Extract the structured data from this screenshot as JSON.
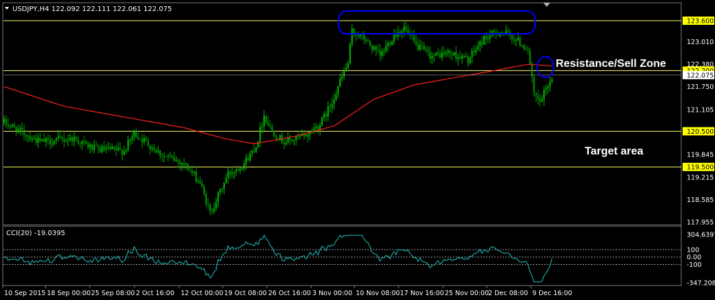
{
  "header": {
    "symbol_line": "USDJPY,H4  122.092 122.111 122.061 122.075",
    "cci_label": "CCI(20) -19.0395"
  },
  "colors": {
    "background": "#000000",
    "bull_candle": "#00c000",
    "bear_candle": "#00a000",
    "moving_average": "#ff2020",
    "level_line": "#ffff66",
    "level_tag_bg": "#ffff00",
    "annotation_ellipse": "#0000ff",
    "cci_line": "#20c0c0",
    "cci_levels": "#a0a0a0"
  },
  "annotations": {
    "resistance": "Resistance/Sell Zone",
    "target": "Target area"
  },
  "chart_data": [
    {
      "type": "candlestick",
      "title": "USDJPY,H4",
      "price_axis_ticks": [
        "123.010",
        "122.380",
        "121.750",
        "121.105",
        "119.845",
        "119.215",
        "118.585",
        "117.955"
      ],
      "ylim": [
        117.955,
        123.6
      ],
      "current_price": "122.075",
      "horizontal_levels": [
        {
          "label": "123.600",
          "value": 123.6
        },
        {
          "label": "122.200",
          "value": 122.2
        },
        {
          "label": "120.500",
          "value": 120.5
        },
        {
          "label": "119.500",
          "value": 119.5
        }
      ],
      "x_tick_labels": [
        "10 Sep 2015",
        "18 Sep 00:00",
        "25 Sep 08:00",
        "2 Oct 16:00",
        "12 Oct 00:00",
        "19 Oct 08:00",
        "26 Oct 16:00",
        "3 Nov 00:00",
        "10 Nov 08:00",
        "17 Nov 16:00",
        "25 Nov 00:00",
        "2 Dec 08:00",
        "9 Dec 16:00"
      ],
      "price_path_keypoints": [
        [
          0,
          120.75
        ],
        [
          8,
          120.5
        ],
        [
          18,
          120.2
        ],
        [
          35,
          120.3
        ],
        [
          45,
          120.0
        ],
        [
          60,
          119.95
        ],
        [
          65,
          120.45
        ],
        [
          80,
          119.8
        ],
        [
          90,
          119.6
        ],
        [
          98,
          119.05
        ],
        [
          103,
          118.2
        ],
        [
          112,
          119.3
        ],
        [
          120,
          119.6
        ],
        [
          126,
          120.1
        ],
        [
          130,
          120.95
        ],
        [
          134,
          120.5
        ],
        [
          140,
          120.2
        ],
        [
          150,
          120.35
        ],
        [
          158,
          120.7
        ],
        [
          163,
          121.2
        ],
        [
          168,
          121.9
        ],
        [
          172,
          122.4
        ],
        [
          174,
          123.3
        ],
        [
          180,
          123.1
        ],
        [
          188,
          122.6
        ],
        [
          195,
          123.2
        ],
        [
          200,
          123.4
        ],
        [
          206,
          122.9
        ],
        [
          214,
          122.6
        ],
        [
          222,
          122.7
        ],
        [
          232,
          122.5
        ],
        [
          240,
          123.1
        ],
        [
          248,
          123.3
        ],
        [
          254,
          123.15
        ],
        [
          262,
          122.8
        ],
        [
          265,
          121.5
        ],
        [
          268,
          121.3
        ],
        [
          272,
          121.8
        ],
        [
          274,
          122.0
        ]
      ],
      "moving_average_keypoints": [
        [
          0,
          121.75
        ],
        [
          30,
          121.2
        ],
        [
          60,
          120.9
        ],
        [
          90,
          120.6
        ],
        [
          110,
          120.3
        ],
        [
          125,
          120.15
        ],
        [
          145,
          120.35
        ],
        [
          165,
          120.65
        ],
        [
          185,
          121.4
        ],
        [
          205,
          121.8
        ],
        [
          225,
          122.0
        ],
        [
          245,
          122.2
        ],
        [
          262,
          122.38
        ],
        [
          274,
          122.33
        ]
      ],
      "candle_count": 275
    },
    {
      "type": "line",
      "title": "CCI(20) -19.0395",
      "levels": [
        100,
        0.0,
        -100
      ],
      "axis_ticks": [
        "304.6397",
        "100",
        "0.00",
        "-100",
        "-347.2086"
      ],
      "ylim": [
        -347.2086,
        304.6397
      ],
      "last_value": -19.0395
    }
  ]
}
